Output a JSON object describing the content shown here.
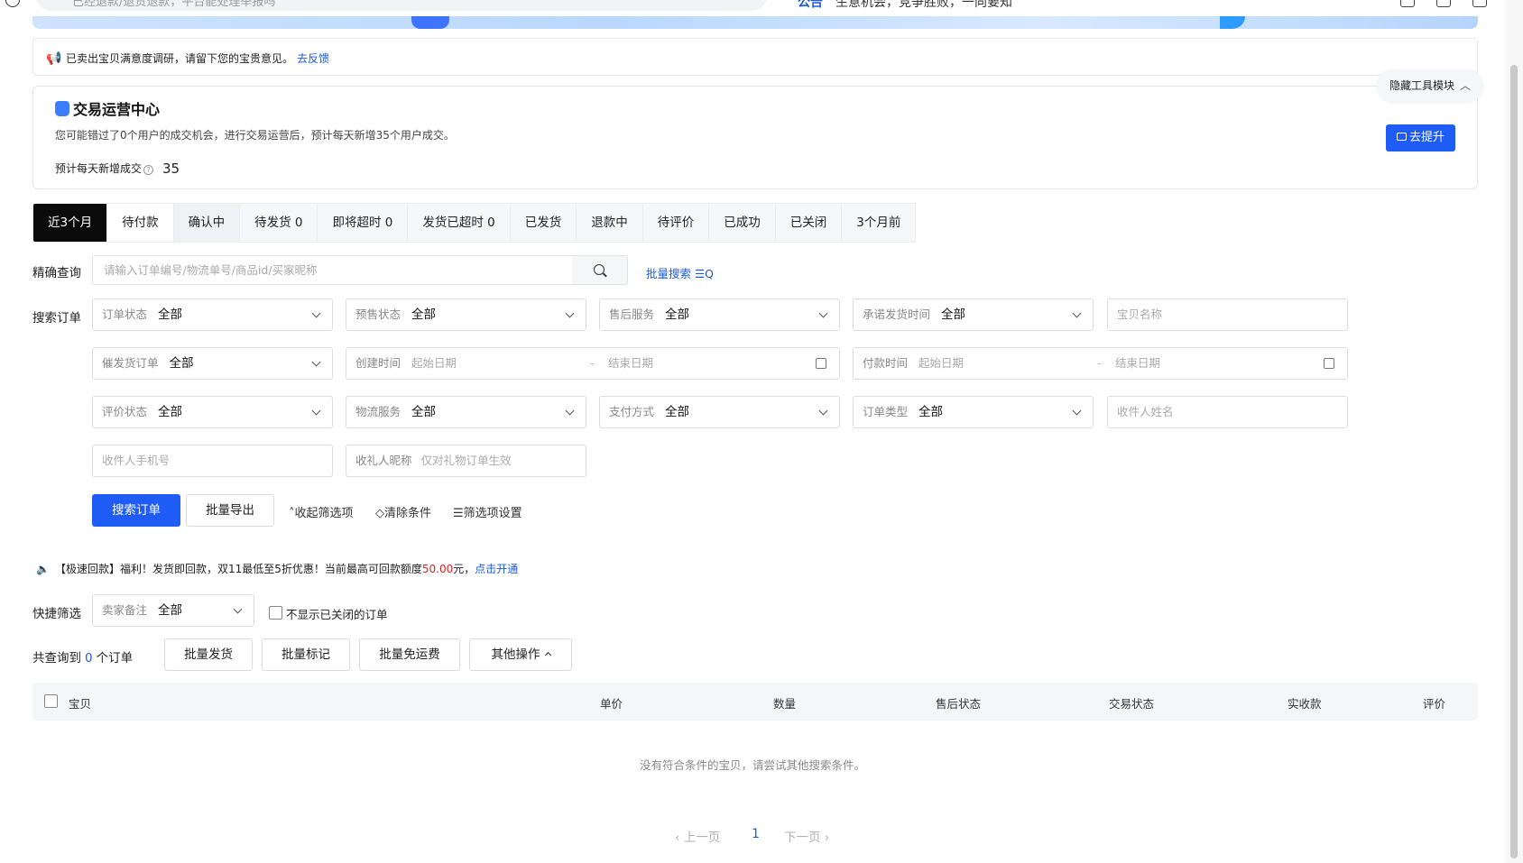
{
  "topbar": {
    "search_placeholder": "已经退款/退货退款，平台能处理举报吗",
    "notice_tag": "公告",
    "notice_text": "生意机会，竞争胜败，一向要知"
  },
  "feedback": {
    "text": "已卖出宝贝满意度调研，请留下您的宝贵意见。",
    "link": "去反馈"
  },
  "ops_center": {
    "title": "交易运营中心",
    "desc": "您可能错过了0个用户的成交机会，进行交易运营后，预计每天新增35个用户成交。",
    "est_label": "预计每天新增成交",
    "est_value": "35",
    "button": "去提升",
    "hide_tools": "隐藏工具模块"
  },
  "tabs": [
    {
      "label": "近3个月"
    },
    {
      "label": "待付款"
    },
    {
      "label": "确认中"
    },
    {
      "label": "待发货 0"
    },
    {
      "label": "即将超时 0"
    },
    {
      "label": "发货已超时 0"
    },
    {
      "label": "已发货"
    },
    {
      "label": "退款中"
    },
    {
      "label": "待评价"
    },
    {
      "label": "已成功"
    },
    {
      "label": "已关闭"
    },
    {
      "label": "3个月前"
    }
  ],
  "precise": {
    "label": "精确查询",
    "placeholder": "请输入订单编号/物流单号/商品id/买家昵称",
    "batch": "批量搜索 ☰Q"
  },
  "search_label": "搜索订单",
  "filters": {
    "order_status": {
      "label": "订单状态",
      "value": "全部"
    },
    "presale_status": {
      "label": "预售状态",
      "value": "全部"
    },
    "aftersale": {
      "label": "售后服务",
      "value": "全部"
    },
    "promise_ship": {
      "label": "承诺发货时间",
      "value": "全部"
    },
    "item_name": {
      "placeholder": "宝贝名称"
    },
    "urge_ship": {
      "label": "催发货订单",
      "value": "全部"
    },
    "create_time": {
      "label": "创建时间",
      "start": "起始日期",
      "end": "结束日期"
    },
    "pay_time": {
      "label": "付款时间",
      "start": "起始日期",
      "end": "结束日期"
    },
    "review_status": {
      "label": "评价状态",
      "value": "全部"
    },
    "logistics": {
      "label": "物流服务",
      "value": "全部"
    },
    "payment": {
      "label": "支付方式",
      "value": "全部"
    },
    "order_type": {
      "label": "订单类型",
      "value": "全部"
    },
    "receiver_name": {
      "placeholder": "收件人姓名"
    },
    "receiver_phone": {
      "placeholder": "收件人手机号"
    },
    "gift_nick": {
      "label": "收礼人昵称",
      "placeholder": "仅对礼物订单生效"
    }
  },
  "actions": {
    "search": "搜索订单",
    "export": "批量导出",
    "collapse": "收起筛选项",
    "clear": "清除条件",
    "settings": "筛选项设置"
  },
  "promo": {
    "prefix": "【极速回款】福利！发货即回款，双11最低至5折优惠！当前最高可回款额度",
    "amount": "50.00",
    "suffix": "元，",
    "link": "点击开通"
  },
  "quick": {
    "label": "快捷筛选",
    "remark_label": "卖家备注",
    "remark_value": "全部",
    "hide_closed": "不显示已关闭的订单"
  },
  "summary": {
    "prefix": "共查询到",
    "count": "0",
    "suffix": "个订单"
  },
  "bulk": {
    "ship": "批量发货",
    "mark": "批量标记",
    "free_ship": "批量免运费",
    "other": "其他操作"
  },
  "table": {
    "columns": [
      "宝贝",
      "单价",
      "数量",
      "售后状态",
      "交易状态",
      "实收款",
      "评价"
    ],
    "empty": "没有符合条件的宝贝，请尝试其他搜索条件。"
  },
  "pager": {
    "prev": "‹ 上一页",
    "current": "1",
    "next": "下一页 ›"
  },
  "colors": {
    "primary": "#1f5bf5",
    "link": "#1d5ad7",
    "active_tab": "#0b0b0b",
    "amount_red": "#e02020"
  }
}
